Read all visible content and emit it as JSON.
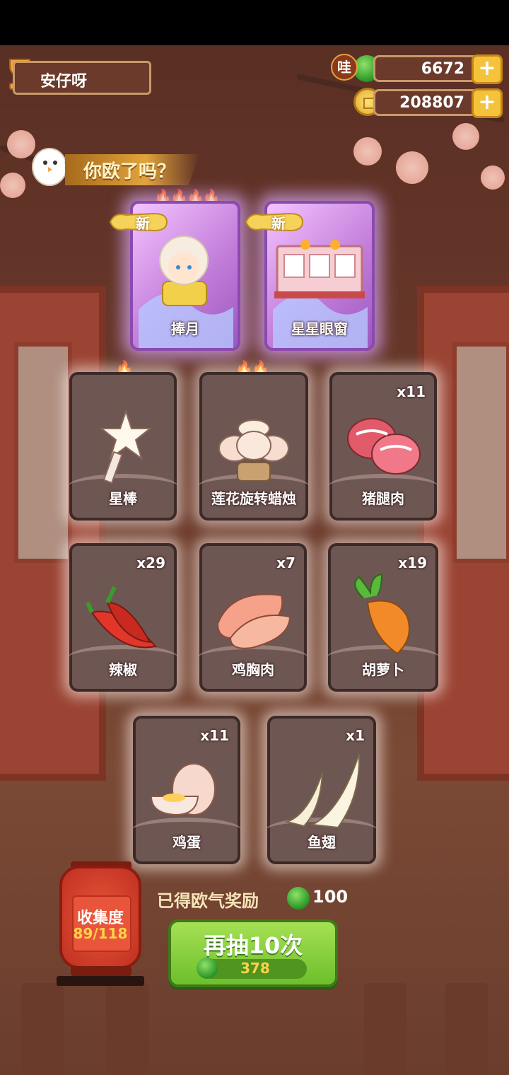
{
  "player": {
    "name": "安仔呀"
  },
  "currency": {
    "jade": {
      "value": "6672",
      "tag": "哇"
    },
    "coin": {
      "value": "208807"
    }
  },
  "banner": {
    "text": "你欧了吗？"
  },
  "new_badge": "新",
  "cards": [
    {
      "label": "捧月",
      "new": true,
      "flames": 4,
      "count": "",
      "style": "purple"
    },
    {
      "label": "星星眼窗",
      "new": true,
      "flames": 0,
      "count": "",
      "style": "purple"
    },
    {
      "label": "星棒",
      "flames": 1,
      "count": ""
    },
    {
      "label": "莲花旋转蜡烛",
      "flames": 2,
      "count": ""
    },
    {
      "label": "猪腿肉",
      "flames": 0,
      "count": "x11"
    },
    {
      "label": "辣椒",
      "flames": 0,
      "count": "x29"
    },
    {
      "label": "鸡胸肉",
      "flames": 0,
      "count": "x7"
    },
    {
      "label": "胡萝卜",
      "flames": 0,
      "count": "x19"
    },
    {
      "label": "鸡蛋",
      "flames": 0,
      "count": "x11"
    },
    {
      "label": "鱼翅",
      "flames": 0,
      "count": "x1"
    }
  ],
  "collection": {
    "title": "收集度",
    "progress": "89/118"
  },
  "reward": {
    "text": "已得欧气奖励",
    "value": "100"
  },
  "draw_button": {
    "label": "再抽10次",
    "cost": "378"
  },
  "colors": {
    "jade": "#3aa62e",
    "gold": "#f5c33a",
    "card_bg": "#6e5653",
    "purple_card": "#c07ad8"
  }
}
